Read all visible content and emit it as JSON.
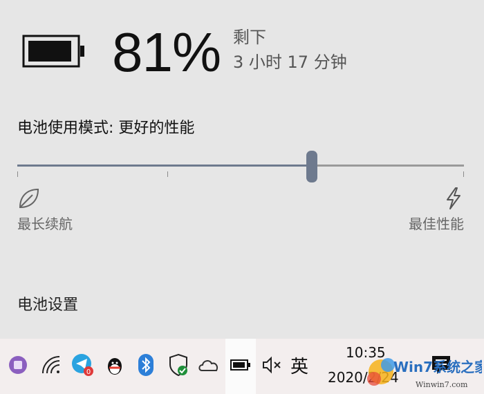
{
  "battery": {
    "percent": "81%",
    "remaining_label": "剩下",
    "remaining_time": "3 小时 17 分钟"
  },
  "power_mode": {
    "title": "电池使用模式: 更好的性能",
    "min_label": "最长续航",
    "max_label": "最佳性能",
    "level_fraction": 0.66,
    "accent": "#6e7a8e"
  },
  "settings_link": "电池设置",
  "taskbar": {
    "language": "英",
    "time": "10:35",
    "date": "2020/2/24",
    "telegram_badge": "0",
    "icons": [
      "app-icon",
      "wifi-icon",
      "telegram-icon",
      "qq-icon",
      "bluetooth-icon",
      "security-shield-icon",
      "onedrive-cloud-icon",
      "battery-icon",
      "volume-mute-icon",
      "notification-icon"
    ]
  },
  "watermark": {
    "brand": "Win7系统之家",
    "url": "Winwin7.com"
  }
}
